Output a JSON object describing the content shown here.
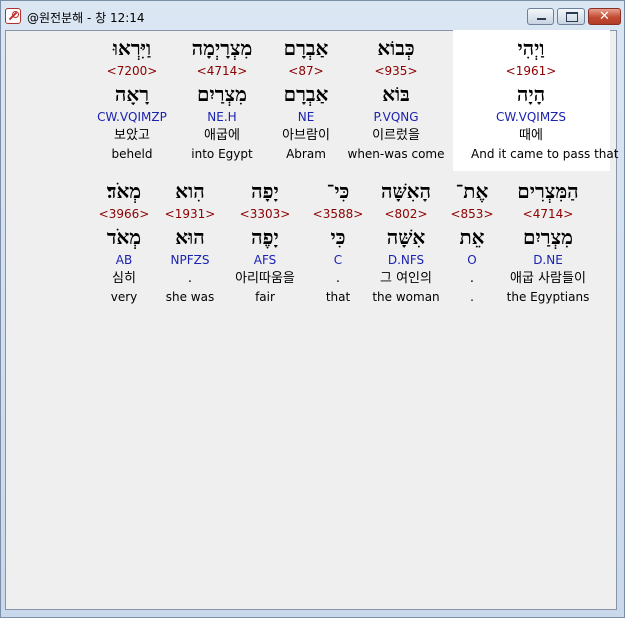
{
  "window": {
    "title": "@원전분해 - 창 12:14",
    "close_glyph": "✕"
  },
  "line1": [
    {
      "surface": "וַיְהִי",
      "strong": "<1961>",
      "lemma": "הָיָה",
      "parse": "CW.VQIMZS",
      "korean": "때에",
      "english": "And it came to pass that"
    },
    {
      "surface": "כְּבוֹא",
      "strong": "<935>",
      "lemma": "בּוֹא",
      "parse": "P.VQNG",
      "korean": "이르렀을",
      "english": "when-was come"
    },
    {
      "surface": "אַבְרָם",
      "strong": "<87>",
      "lemma": "אַבְרָם",
      "parse": "NE",
      "korean": "아브람이",
      "english": "Abram"
    },
    {
      "surface": "מִצְרָיְמָה",
      "strong": "<4714>",
      "lemma": "מִצְרַיִם",
      "parse": "NE.H",
      "korean": "애굽에",
      "english": "into Egypt"
    },
    {
      "surface": "וַיִּרְאוּ",
      "strong": "<7200>",
      "lemma": "רָאָה",
      "parse": "CW.VQIMZP",
      "korean": "보았고",
      "english": "beheld"
    }
  ],
  "line2": [
    {
      "surface": "הַמִּצְרִים",
      "strong": "<4714>",
      "lemma": "מִצְרַיִם",
      "parse": "D.NE",
      "korean": "애굽 사람들이",
      "english": "the Egyptians"
    },
    {
      "surface": "אֶת־",
      "strong": "<853>",
      "lemma": "אֵת",
      "parse": "O",
      "korean": ".",
      "english": "."
    },
    {
      "surface": "הָאִשָּׁה",
      "strong": "<802>",
      "lemma": "אִשָּׁה",
      "parse": "D.NFS",
      "korean": "그 여인의",
      "english": "the woman"
    },
    {
      "surface": "כִּי־",
      "strong": "<3588>",
      "lemma": "כִּי",
      "parse": "C",
      "korean": ".",
      "english": "that"
    },
    {
      "surface": "יָפָה",
      "strong": "<3303>",
      "lemma": "יָפֶה",
      "parse": "AFS",
      "korean": "아리따움을",
      "english": "fair"
    },
    {
      "surface": "הִוא",
      "strong": "<1931>",
      "lemma": "הוּא",
      "parse": "NPFZS",
      "korean": ".",
      "english": "she was"
    },
    {
      "surface": "מְאֹד׃",
      "strong": "<3966>",
      "lemma": "מְאֹד",
      "parse": "AB",
      "korean": "심히",
      "english": "very"
    }
  ]
}
